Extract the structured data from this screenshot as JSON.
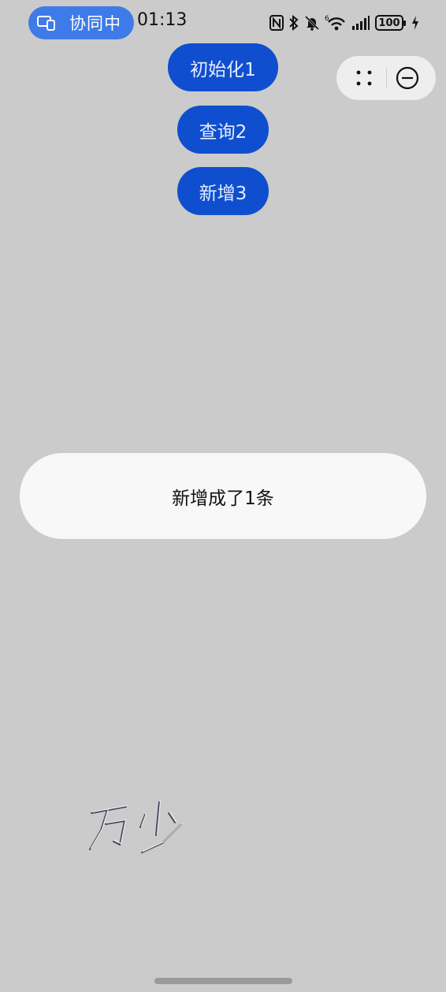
{
  "status_bar": {
    "collab_label": "协同中",
    "time": "01:13",
    "network_superscript": "6",
    "battery": "100",
    "icons": [
      "nfc-icon",
      "bluetooth-icon",
      "bell-muted-icon",
      "wifi-icon",
      "signal-icon",
      "battery-icon",
      "charging-icon"
    ]
  },
  "capsule": {
    "more_icon": "dots-icon",
    "close_icon": "minus-circle-icon"
  },
  "buttons": {
    "init": "初始化1",
    "query": "查询2",
    "add": "新增3"
  },
  "toast": {
    "message": "新增成了1条"
  },
  "watermark": {
    "text": "万少"
  },
  "colors": {
    "background": "#cbcbcb",
    "button": "#0f4fcf",
    "collab_pill": "#3f7be8",
    "toast": "#f8f8f8"
  }
}
